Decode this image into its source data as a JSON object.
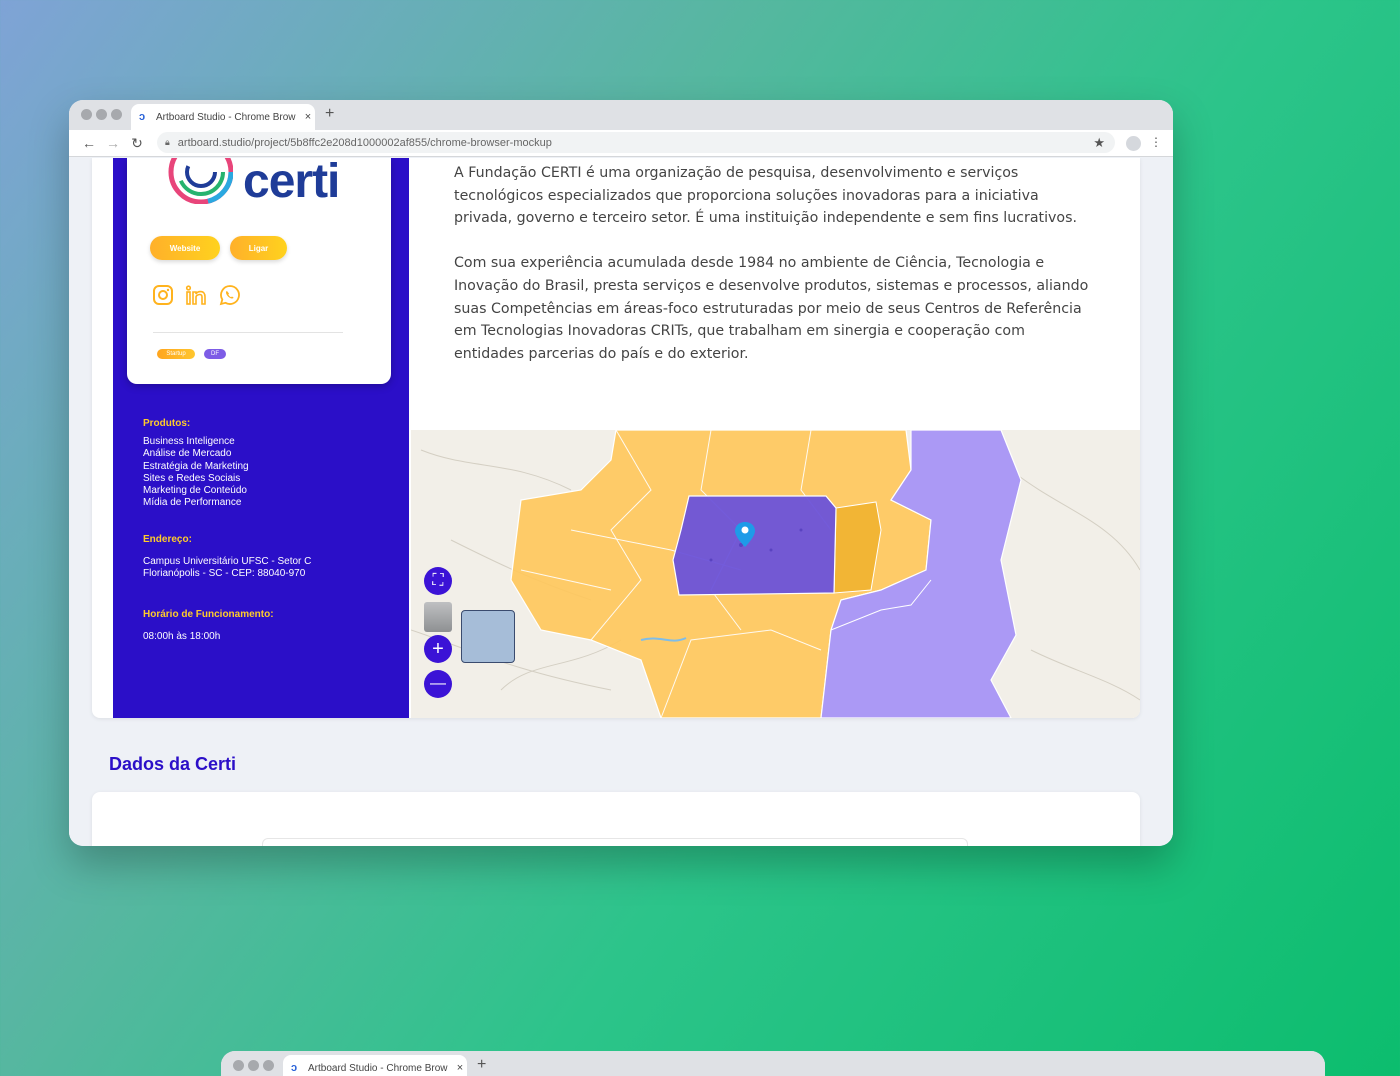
{
  "browser": {
    "tab_title": "Artboard Studio - Chrome Brow",
    "tab_close": "×",
    "new_tab": "+",
    "url": "artboard.studio/project/5b8ffc2e208d1000002af855/chrome-browser-mockup",
    "icons": [
      "back-arrow-icon",
      "forward-arrow-icon",
      "reload-icon",
      "lock-icon",
      "star-icon",
      "profile-icon",
      "more-vert-icon"
    ]
  },
  "profile": {
    "logo_text": "certi",
    "website_button": "Website",
    "call_button": "Ligar",
    "social_icons": [
      "instagram-icon",
      "linkedin-icon",
      "whatsapp-icon"
    ],
    "tags": [
      "Startup",
      "DF"
    ]
  },
  "sidebar": {
    "products_heading": "Produtos:",
    "products": [
      "Business Inteligence",
      "Análise de Mercado",
      "Estratégia de Marketing",
      "Sites e Redes Sociais",
      "Marketing de Conteúdo",
      "Mídia de Performance"
    ],
    "address_heading": "Endereço:",
    "address_lines": [
      "Campus Universitário UFSC - Setor C",
      "Florianópolis - SC - CEP: 88040-970"
    ],
    "hours_heading": "Horário de Funcionamento:",
    "hours": "08:00h às 18:00h"
  },
  "description": {
    "paragraph1": "A Fundação CERTI é uma organização de pesquisa, desenvolvimento e serviços tecnológicos especializados que proporciona soluções inovadoras para a iniciativa privada, governo e terceiro setor. É uma instituição independente e sem fins lucrativos.",
    "paragraph2": "Com sua experiência acumulada desde 1984 no ambiente de Ciência, Tecnologia e Inovação do Brasil, presta serviços e desenvolve produtos, sistemas e processos, aliando suas Competências em áreas-foco estruturadas por meio de seus Centros de Referência em Tecnologias Inovadoras CRITs, que trabalham em sinergia e cooperação com entidades parcerias do país e do exterior."
  },
  "map": {
    "controls": {
      "fullscreen": "⛶",
      "zoom_in": "+",
      "zoom_out": "—"
    },
    "colors": {
      "orange": "#ffc65a",
      "purple_light": "#ab99f5",
      "purple_dark": "#6b52d9",
      "pin": "#1e9be8"
    }
  },
  "section": {
    "title": "Dados da Certi"
  },
  "colors": {
    "brand_blue": "#2b0fc8",
    "accent_yellow": "#ffcc2b"
  }
}
